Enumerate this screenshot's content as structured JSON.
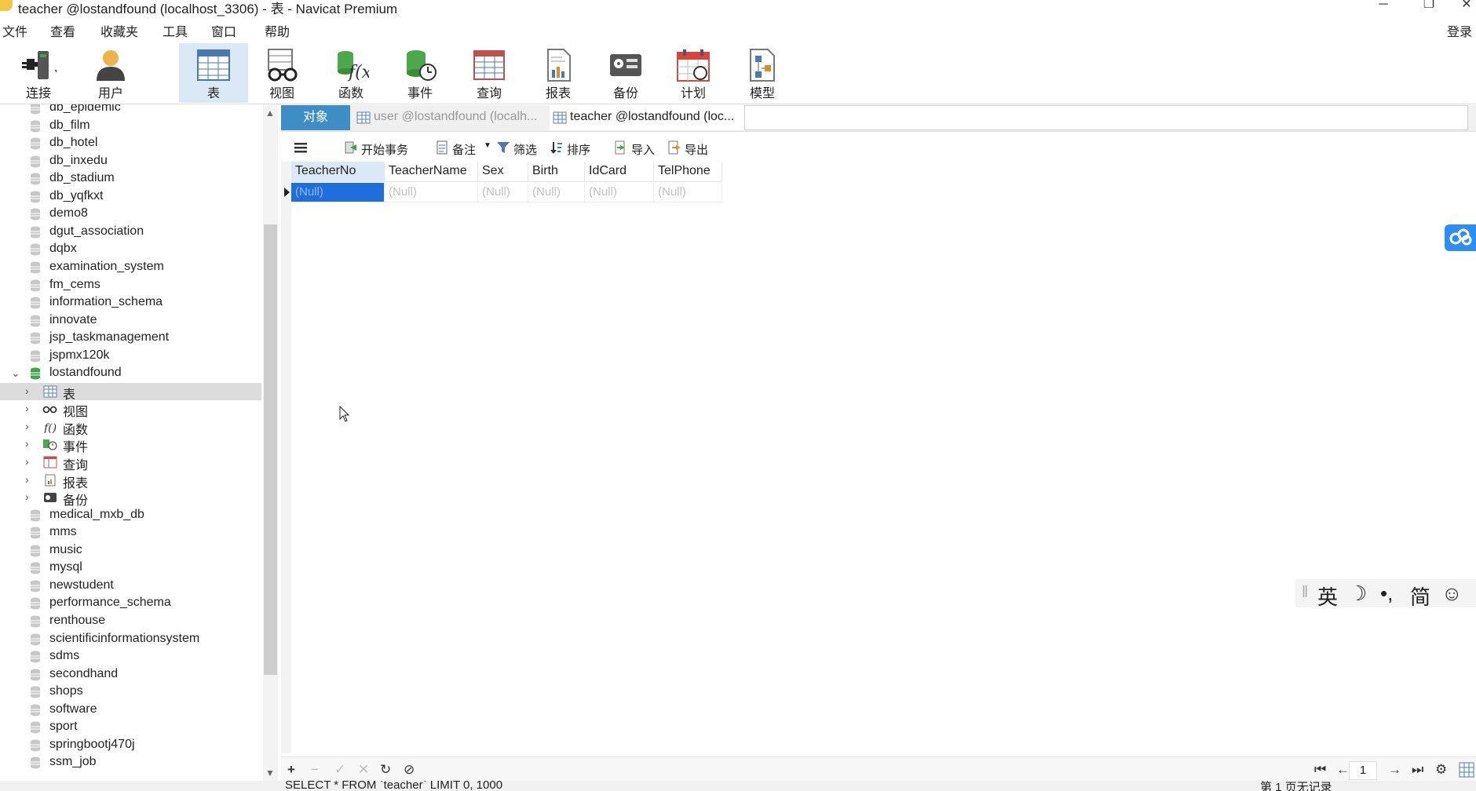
{
  "window": {
    "title": "teacher @lostandfound (localhost_3306) - 表 - Navicat Premium",
    "login": "登录"
  },
  "menu": [
    "文件",
    "查看",
    "收藏夹",
    "工具",
    "窗口",
    "帮助"
  ],
  "toolbar": {
    "items": [
      {
        "label": "连接",
        "icon": "plug-icon"
      },
      {
        "label": "用户",
        "icon": "user-icon"
      },
      {
        "label": "表",
        "icon": "table-icon",
        "active": true
      },
      {
        "label": "视图",
        "icon": "view-glasses-icon"
      },
      {
        "label": "函数",
        "icon": "function-icon"
      },
      {
        "label": "事件",
        "icon": "event-clock-icon"
      },
      {
        "label": "查询",
        "icon": "query-icon"
      },
      {
        "label": "报表",
        "icon": "report-icon"
      },
      {
        "label": "备份",
        "icon": "backup-icon"
      },
      {
        "label": "计划",
        "icon": "schedule-calendar-icon"
      },
      {
        "label": "模型",
        "icon": "model-icon"
      }
    ]
  },
  "tree": {
    "databases_top": [
      "db_epidemic",
      "db_film",
      "db_hotel",
      "db_inxedu",
      "db_stadium",
      "db_yqfkxt",
      "demo8",
      "dgut_association",
      "dqbx",
      "examination_system",
      "fm_cems",
      "information_schema",
      "innovate",
      "jsp_taskmanagement",
      "jspmx120k"
    ],
    "open_database": "lostandfound",
    "children": [
      "表",
      "视图",
      "函数",
      "事件",
      "查询",
      "报表",
      "备份"
    ],
    "databases_bottom": [
      "medical_mxb_db",
      "mms",
      "music",
      "mysql",
      "newstudent",
      "performance_schema",
      "renthouse",
      "scientificinformationsystem",
      "sdms",
      "secondhand",
      "shops",
      "software",
      "sport",
      "springbootj470j",
      "ssm_job"
    ]
  },
  "tabs": {
    "objects": "对象",
    "tab1": "user @lostandfound (localh...",
    "tab2": "teacher @lostandfound (loc..."
  },
  "data_toolbar": {
    "begin_transaction": "开始事务",
    "memo": "备注",
    "filter": "筛选",
    "sort": "排序",
    "import": "导入",
    "export": "导出"
  },
  "grid": {
    "columns": [
      "TeacherNo",
      "TeacherName",
      "Sex",
      "Birth",
      "IdCard",
      "TelPhone"
    ],
    "rows": [
      [
        "(Null)",
        "(Null)",
        "(Null)",
        "(Null)",
        "(Null)",
        "(Null)"
      ]
    ]
  },
  "ime": [
    "英",
    "☽",
    "•,",
    "简",
    "☺"
  ],
  "bottom": {
    "page": "1"
  },
  "status": {
    "sql": "SELECT * FROM `teacher` LIMIT 0, 1000",
    "records": "第 1 页无记录"
  }
}
